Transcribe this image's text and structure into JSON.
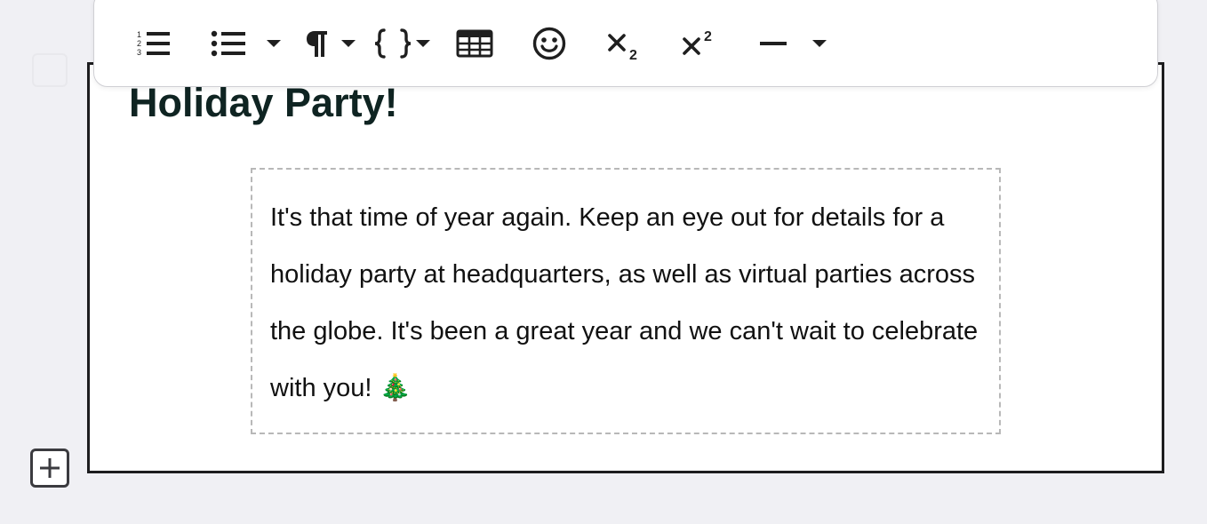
{
  "editor": {
    "heading": "Holiday Party!",
    "paragraph": "It's that time of year again. Keep an eye out for details for a holiday party at headquarters, as well as virtual parties across the globe. It's been a great year and we can't wait to celebrate with you! 🎄"
  },
  "toolbar": {
    "buttons": [
      {
        "name": "ordered-list-icon"
      },
      {
        "name": "bulleted-list-icon"
      },
      {
        "name": "bulleted-list-dropdown"
      },
      {
        "name": "paragraph-icon"
      },
      {
        "name": "code-icon"
      },
      {
        "name": "table-icon"
      },
      {
        "name": "emoji-icon"
      },
      {
        "name": "subscript-icon"
      },
      {
        "name": "superscript-icon"
      },
      {
        "name": "horizontal-rule-icon"
      },
      {
        "name": "more-dropdown"
      }
    ]
  },
  "colors": {
    "background": "#f0f0f4",
    "heading": "#0f2422",
    "card_border": "#1d1d1f",
    "dashed_border": "#b8b8b8"
  }
}
